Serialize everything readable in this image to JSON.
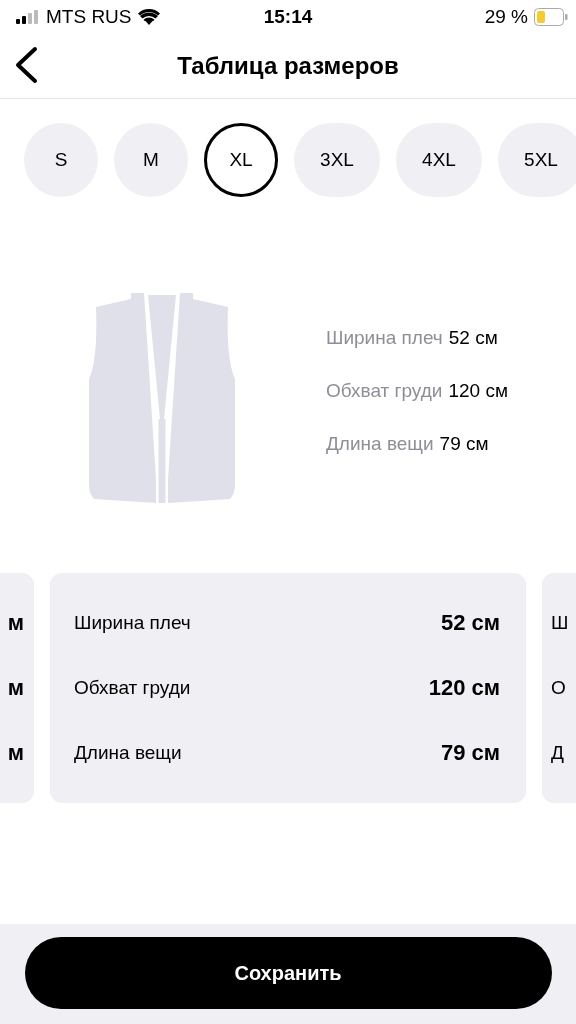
{
  "status_bar": {
    "carrier": "MTS RUS",
    "time": "15:14",
    "battery": "29 %"
  },
  "header": {
    "title": "Таблица размеров"
  },
  "sizes": [
    {
      "label": "S",
      "selected": false
    },
    {
      "label": "M",
      "selected": false
    },
    {
      "label": "XL",
      "selected": true
    },
    {
      "label": "3XL",
      "selected": false
    },
    {
      "label": "4XL",
      "selected": false
    },
    {
      "label": "5XL",
      "selected": false
    }
  ],
  "summary": [
    {
      "label": "Ширина плеч",
      "value": "52 см"
    },
    {
      "label": "Обхват груди",
      "value": "120 см"
    },
    {
      "label": "Длина вещи",
      "value": "79 см"
    }
  ],
  "previous_card": {
    "rows": [
      "м",
      "м",
      "м"
    ]
  },
  "card": {
    "rows": [
      {
        "label": "Ширина плеч",
        "value": "52 см"
      },
      {
        "label": "Обхват груди",
        "value": "120 см"
      },
      {
        "label": "Длина вещи",
        "value": "79 см"
      }
    ]
  },
  "next_card": {
    "rows": [
      "Ш",
      "О",
      "Д"
    ]
  },
  "save_button": "Сохранить"
}
